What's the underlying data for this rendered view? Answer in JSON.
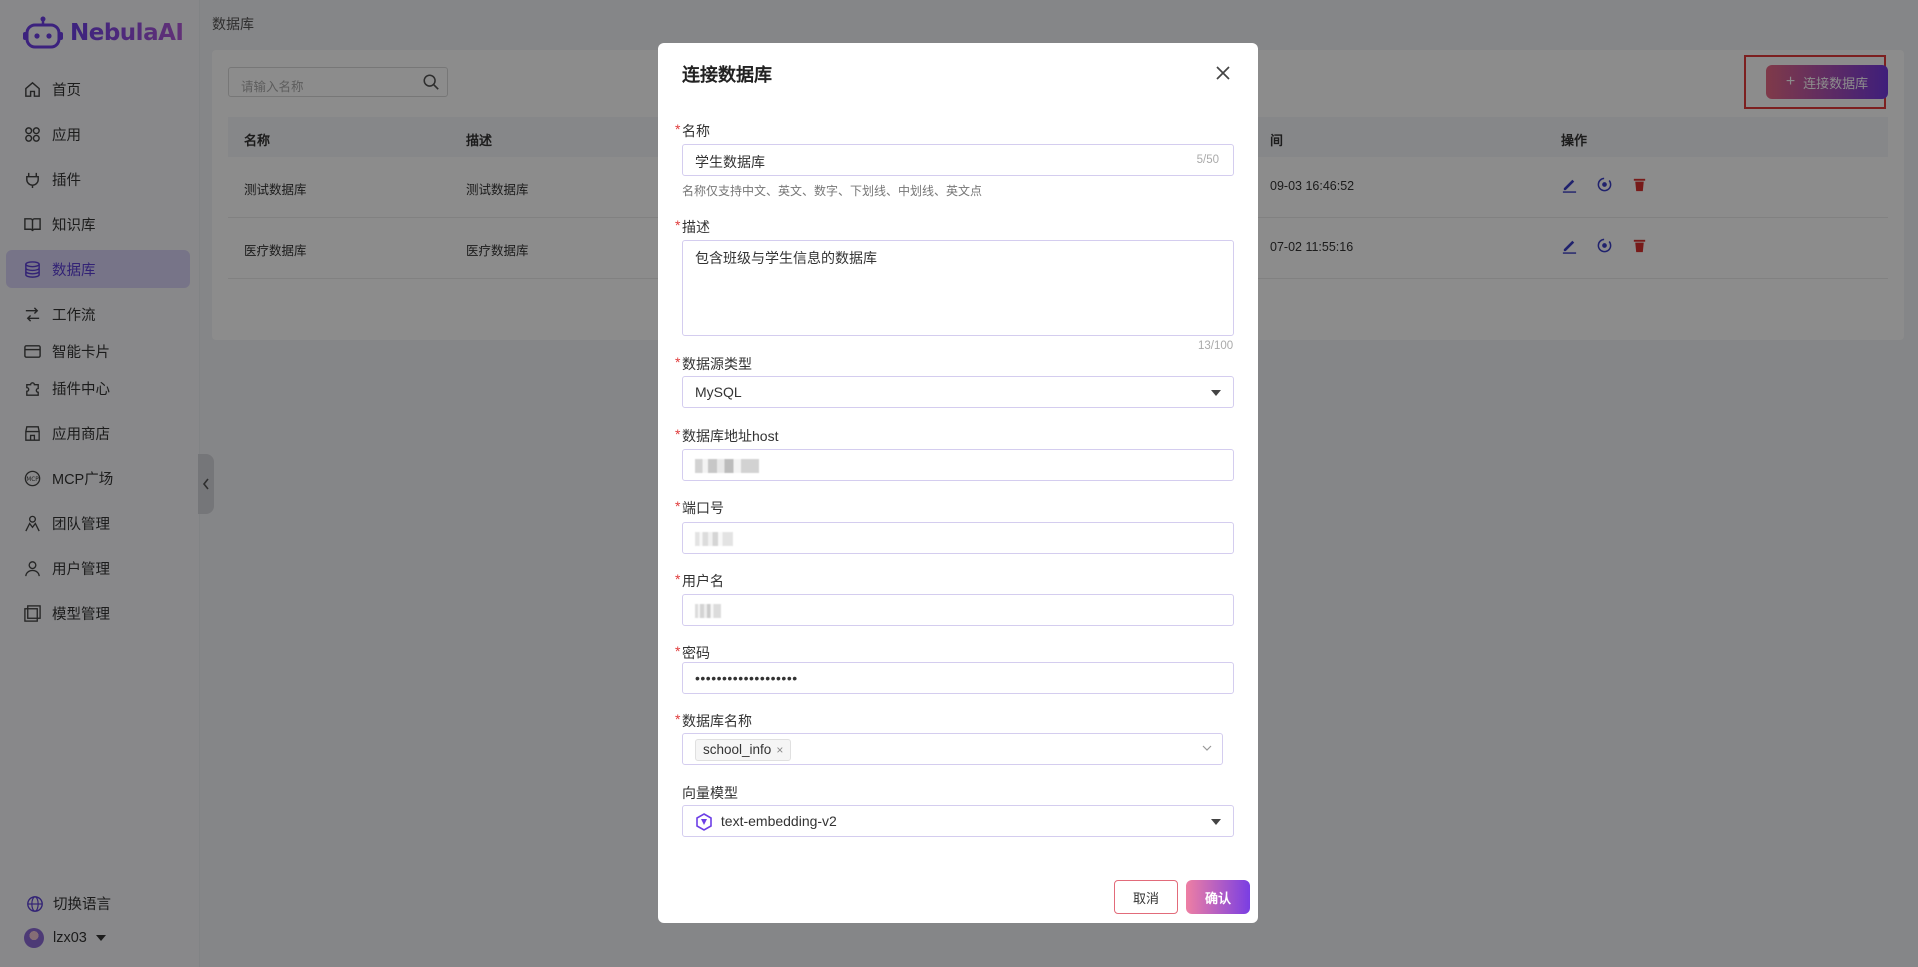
{
  "app": {
    "name": "NebulaAI"
  },
  "sidebar": {
    "items": [
      {
        "label": "首页",
        "icon": "home-icon"
      },
      {
        "label": "应用",
        "icon": "apps-icon"
      },
      {
        "label": "插件",
        "icon": "plug-icon"
      },
      {
        "label": "知识库",
        "icon": "book-icon"
      },
      {
        "label": "数据库",
        "icon": "database-icon",
        "active": true
      },
      {
        "label": "工作流",
        "icon": "workflow-icon"
      },
      {
        "label": "智能卡片",
        "icon": "card-icon"
      },
      {
        "label": "插件中心",
        "icon": "puzzle-icon"
      },
      {
        "label": "应用商店",
        "icon": "store-icon"
      },
      {
        "label": "MCP广场",
        "icon": "mcp-icon"
      },
      {
        "label": "团队管理",
        "icon": "team-icon"
      },
      {
        "label": "用户管理",
        "icon": "user-icon"
      },
      {
        "label": "模型管理",
        "icon": "model-icon"
      }
    ],
    "language_label": "切换语言",
    "username": "lzx03"
  },
  "page": {
    "breadcrumb": "数据库",
    "search_placeholder": "请输入名称",
    "connect_button": "连接数据库",
    "table": {
      "headers": [
        "名称",
        "描述",
        "间",
        "操作"
      ],
      "rows": [
        {
          "name": "测试数据库",
          "desc": "测试数据库",
          "time": "09-03 16:46:52"
        },
        {
          "name": "医疗数据库",
          "desc": "医疗数据库",
          "time": "07-02 11:55:16"
        }
      ]
    }
  },
  "modal": {
    "title": "连接数据库",
    "name": {
      "label": "名称",
      "value": "学生数据库",
      "counter": "5/50",
      "hint": "名称仅支持中文、英文、数字、下划线、中划线、英文点"
    },
    "description": {
      "label": "描述",
      "value": "包含班级与学生信息的数据库",
      "counter": "13/100"
    },
    "source_type": {
      "label": "数据源类型",
      "value": "MySQL"
    },
    "host": {
      "label": "数据库地址host"
    },
    "port": {
      "label": "端口号"
    },
    "username": {
      "label": "用户名"
    },
    "password": {
      "label": "密码",
      "value": "•••••••••••••••••••"
    },
    "db_name": {
      "label": "数据库名称",
      "tag": "school_info"
    },
    "vector_model": {
      "label": "向量模型",
      "value": "text-embedding-v2"
    },
    "cancel": "取消",
    "confirm": "确认"
  },
  "colors": {
    "accent": "#6d3fe6",
    "danger": "#e03b3b",
    "active_nav_bg": "#d9d3f7"
  }
}
